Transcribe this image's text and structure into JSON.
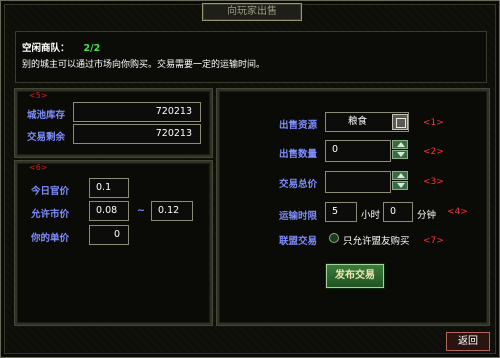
{
  "window": {
    "title": "向玩家出售",
    "return_label": "返回"
  },
  "header": {
    "idle_caravan_label": "空闲商队：",
    "idle_caravan_count": "2/2",
    "description": "别的城主可以通过市场向你购买。交易需要一定的运输时间。"
  },
  "stock_panel": {
    "tag": "<5>",
    "city_stock_label": "城池库存",
    "city_stock_value": "720213",
    "trade_remaining_label": "交易剩余",
    "trade_remaining_value": "720213"
  },
  "price_panel": {
    "tag": "<6>",
    "official_price_label": "今日官价",
    "official_price_value": "0.1",
    "allowed_price_label": "允许市价",
    "allowed_price_min": "0.08",
    "range_sep": "~",
    "allowed_price_max": "0.12",
    "your_price_label": "你的单价",
    "your_price_value": "0"
  },
  "sell_panel": {
    "resource_label": "出售资源",
    "resource_value": "粮食",
    "resource_tag": "<1>",
    "quantity_label": "出售数量",
    "quantity_value": "0",
    "quantity_tag": "<2>",
    "total_label": "交易总价",
    "total_value": "",
    "total_tag": "<3>",
    "transport_label": "运输时限",
    "hours_value": "5",
    "hours_unit": "小时",
    "minutes_value": "0",
    "minutes_unit": "分钟",
    "transport_tag": "<4>",
    "alliance_label": "联盟交易",
    "alliance_option": "只允许盟友购买",
    "alliance_tag": "<7>",
    "publish_label": "发布交易"
  },
  "colors": {
    "label_blue": "#7e8cfc",
    "tag_red": "#ff3030",
    "count_green": "#49e04a",
    "button_green": "#2e6a30"
  }
}
